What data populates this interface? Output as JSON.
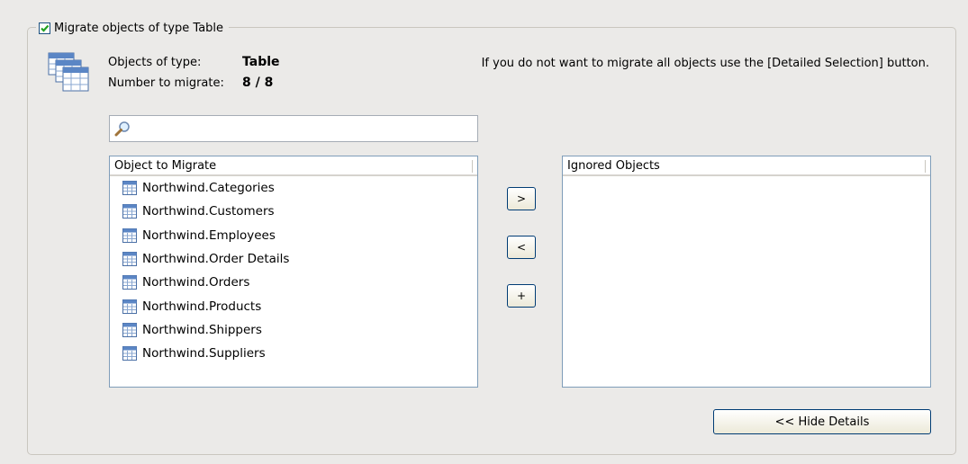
{
  "group": {
    "checked": true,
    "title": "Migrate objects of type Table"
  },
  "info": {
    "type_label": "Objects of type:",
    "type_value": "Table",
    "count_label": "Number to migrate:",
    "count_value": "8 / 8",
    "hint": "If you do not want to migrate all objects use the [Detailed Selection] button."
  },
  "search": {
    "value": "",
    "icon": "search-icon"
  },
  "migrate_list": {
    "header": "Object to Migrate",
    "items": [
      "Northwind.Categories",
      "Northwind.Customers",
      "Northwind.Employees",
      "Northwind.Order Details",
      "Northwind.Orders",
      "Northwind.Products",
      "Northwind.Shippers",
      "Northwind.Suppliers"
    ]
  },
  "ignored_list": {
    "header": "Ignored Objects",
    "items": []
  },
  "buttons": {
    "move_right": ">",
    "move_left": "<",
    "add": "+",
    "hide_details": "<< Hide Details"
  },
  "colors": {
    "background": "#ebeae8",
    "checkmark": "#21a121",
    "list_border": "#7f9db9",
    "button_border": "#003c74"
  }
}
